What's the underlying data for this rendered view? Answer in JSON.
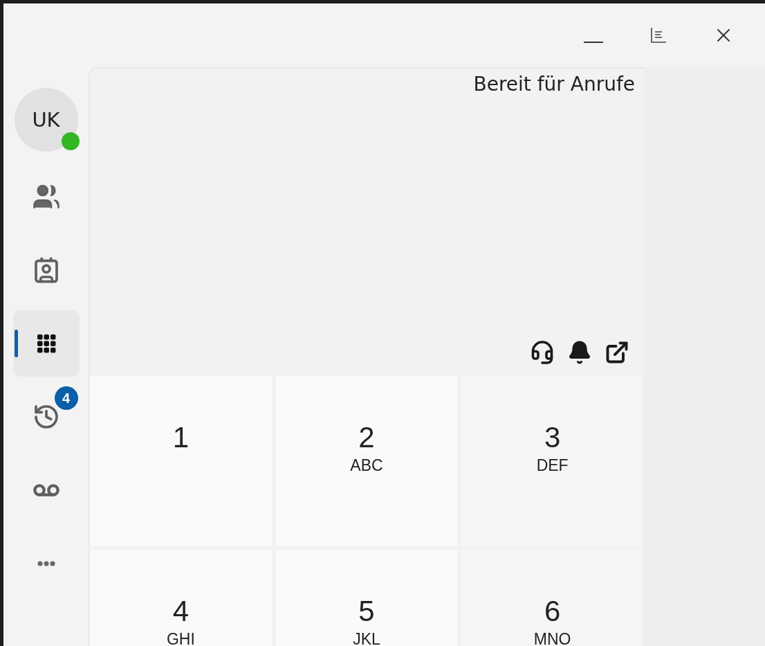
{
  "status_text": "Bereit für Anrufe",
  "profile": {
    "initials": "UK",
    "online": true
  },
  "nav": [
    {
      "kind": "contacts",
      "selected": false
    },
    {
      "kind": "address-book",
      "selected": false
    },
    {
      "kind": "dialpad",
      "selected": true
    },
    {
      "kind": "history",
      "selected": false,
      "badge": "4"
    },
    {
      "kind": "voicemail",
      "selected": false
    },
    {
      "kind": "more",
      "selected": false
    }
  ],
  "keys": [
    {
      "digit": "1"
    },
    {
      "digit": "2",
      "letters": "ABC"
    },
    {
      "digit": "3",
      "letters": "DEF"
    },
    {
      "digit": "4",
      "letters": "GHI"
    },
    {
      "digit": "5",
      "letters": "JKL"
    },
    {
      "digit": "6",
      "letters": "MNO"
    }
  ]
}
